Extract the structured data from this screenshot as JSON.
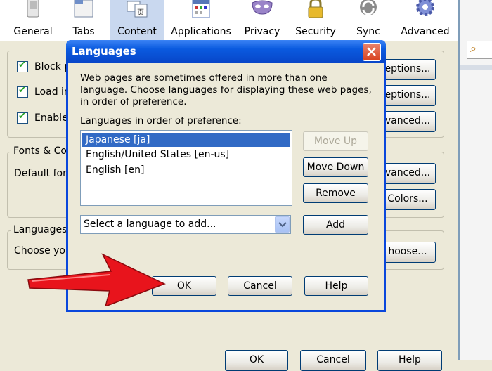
{
  "toolbar": {
    "items": [
      {
        "label": "General",
        "icon": "switch-icon"
      },
      {
        "label": "Tabs",
        "icon": "tabs-icon"
      },
      {
        "label": "Content",
        "icon": "content-icon"
      },
      {
        "label": "Applications",
        "icon": "applications-icon"
      },
      {
        "label": "Privacy",
        "icon": "privacy-mask-icon"
      },
      {
        "label": "Security",
        "icon": "lock-icon"
      },
      {
        "label": "Sync",
        "icon": "sync-icon"
      },
      {
        "label": "Advanced",
        "icon": "gear-icon"
      }
    ],
    "active": "Content"
  },
  "content_panel": {
    "block_popups": "Block p",
    "load_images": "Load in",
    "enable_js": "Enable",
    "exceptions1": "eptions...",
    "exceptions2": "eptions...",
    "advanced1": "vanced...",
    "fonts_group": "Fonts & Col",
    "default_font": "Default fon",
    "advanced2": "vanced...",
    "colors": "Colors...",
    "languages_group": "Languages",
    "choose_text": "Choose you",
    "choose_btn": "hoose...",
    "ok": "OK",
    "cancel": "Cancel",
    "help": "Help"
  },
  "dialog": {
    "title": "Languages",
    "description": "Web pages are sometimes offered in more than one language. Choose languages for displaying these web pages, in order of preference.",
    "list_label": "Languages in order of preference:",
    "languages": [
      "Japanese  [ja]",
      "English/United States  [en-us]",
      "English  [en]"
    ],
    "selected_index": 0,
    "select_placeholder": "Select a language to add...",
    "buttons": {
      "move_up": "Move Up",
      "move_down": "Move Down",
      "remove": "Remove",
      "add": "Add",
      "ok": "OK",
      "cancel": "Cancel",
      "help": "Help"
    }
  },
  "colors": {
    "title_bar": "#0a5adf",
    "selection": "#316ac5",
    "arrow": "#e8141c",
    "close_button": "#d9421f"
  }
}
